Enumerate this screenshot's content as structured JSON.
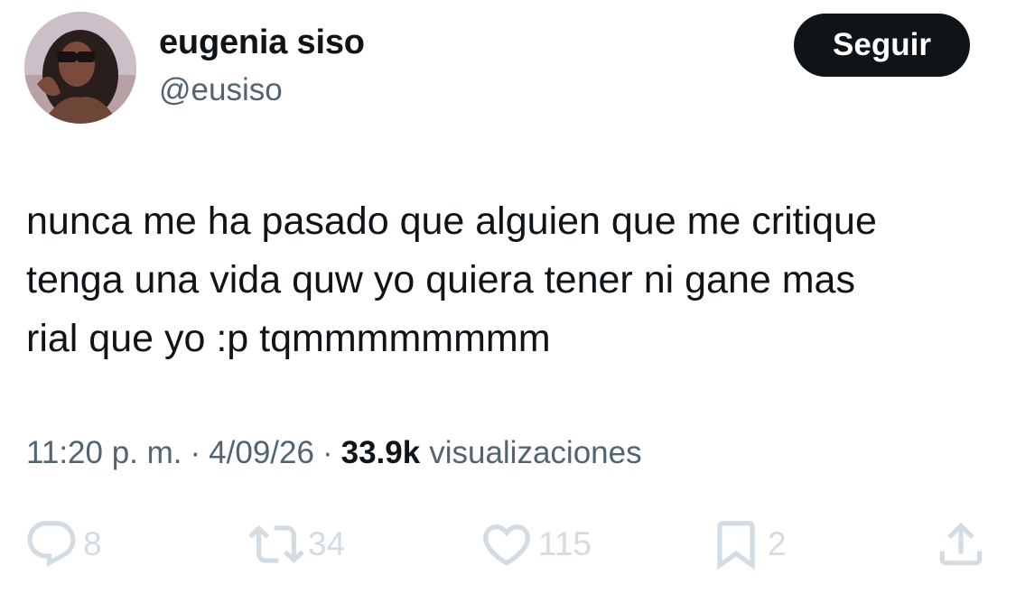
{
  "author": {
    "name": "eugenia siso",
    "handle": "@eusiso",
    "follow_label": "Seguir"
  },
  "tweet": {
    "text": "nunca me ha pasado que alguien que me critique\ntenga una vida quw yo quiera tener ni gane mas\nrial que yo :p tqmmmmmmmm"
  },
  "meta": {
    "time": "11:20 p. m.",
    "separator": "·",
    "date": "4/09/26",
    "views_count": "33.9k",
    "views_label": "visualizaciones"
  },
  "actions": {
    "replies": "8",
    "reposts": "34",
    "likes": "115",
    "bookmarks": "2"
  },
  "colors": {
    "text": "#0f1419",
    "secondary": "#536471",
    "action_icons": "#d3dce2",
    "button_bg": "#0f1419"
  },
  "icons": [
    "reply-icon",
    "repost-icon",
    "like-icon",
    "bookmark-icon",
    "share-icon"
  ]
}
